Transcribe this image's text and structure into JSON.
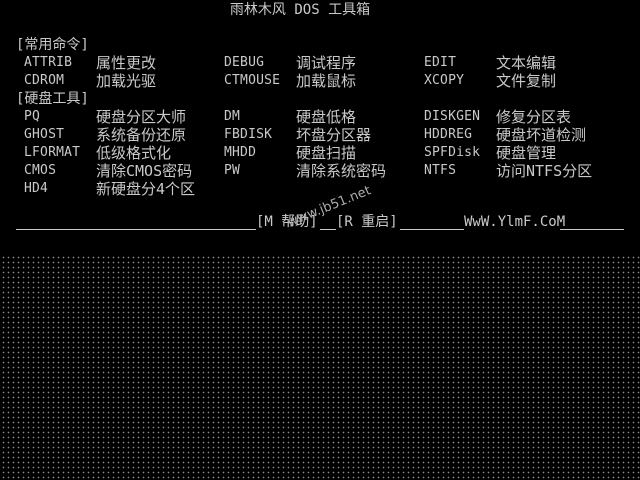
{
  "title": "雨林木风 DOS 工具箱",
  "sections": {
    "common": "[常用命令]",
    "disk": "[硬盘工具]"
  },
  "common_rows": [
    [
      {
        "cmd": "ATTRIB",
        "desc": "属性更改"
      },
      {
        "cmd": "DEBUG",
        "desc": "调试程序"
      },
      {
        "cmd": "EDIT",
        "desc": "文本编辑"
      }
    ],
    [
      {
        "cmd": "CDROM",
        "desc": "加载光驱"
      },
      {
        "cmd": "CTMOUSE",
        "desc": "加载鼠标"
      },
      {
        "cmd": "XCOPY",
        "desc": "文件复制"
      }
    ]
  ],
  "disk_rows": [
    [
      {
        "cmd": "PQ",
        "desc": "硬盘分区大师"
      },
      {
        "cmd": "DM",
        "desc": "硬盘低格"
      },
      {
        "cmd": "DISKGEN",
        "desc": "修复分区表"
      }
    ],
    [
      {
        "cmd": "GHOST",
        "desc": "系统备份还原"
      },
      {
        "cmd": "FBDISK",
        "desc": "坏盘分区器"
      },
      {
        "cmd": "HDDREG",
        "desc": "硬盘坏道检测"
      }
    ],
    [
      {
        "cmd": "LFORMAT",
        "desc": "低级格式化"
      },
      {
        "cmd": "MHDD",
        "desc": "硬盘扫描"
      },
      {
        "cmd": "SPFDisk",
        "desc": "硬盘管理"
      }
    ],
    [
      {
        "cmd": "CMOS",
        "desc": "清除CMOS密码"
      },
      {
        "cmd": "PW",
        "desc": "清除系统密码"
      },
      {
        "cmd": "NTFS",
        "desc": "访问NTFS分区"
      }
    ],
    [
      {
        "cmd": "HD4",
        "desc": "新硬盘分4个区"
      }
    ]
  ],
  "footer": {
    "help": "[M 帮助]",
    "restart": "[R 重启]",
    "website": "WwW.YlmF.CoM"
  },
  "watermark": "www.jb51.net",
  "colors": {
    "background": "#000000",
    "text": "#c9c9c9"
  }
}
